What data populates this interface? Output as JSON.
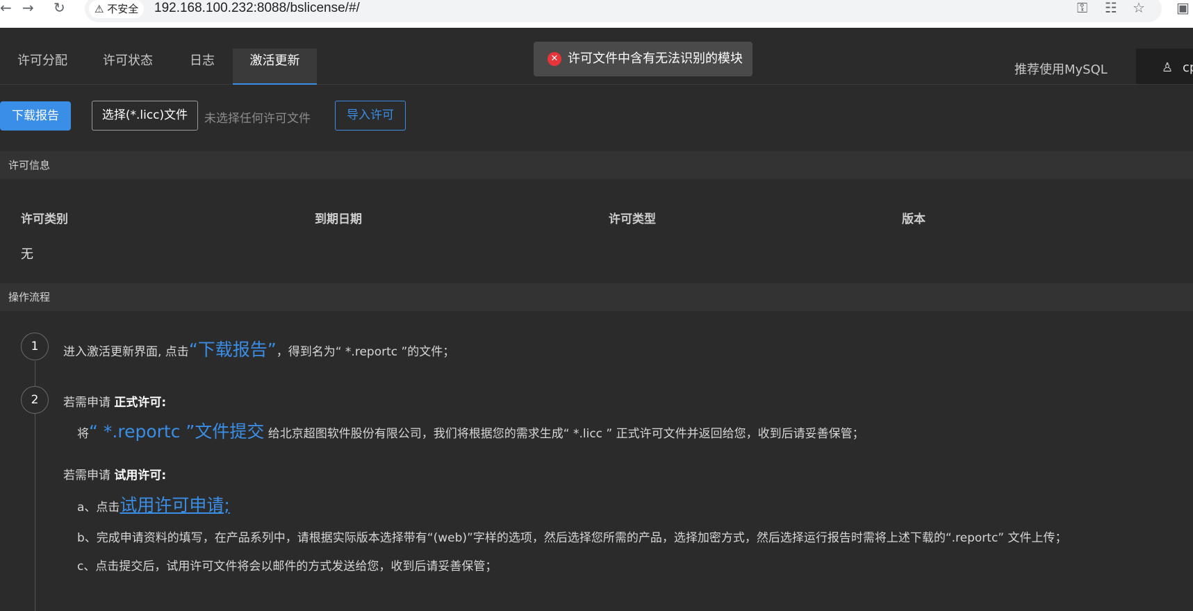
{
  "browser": {
    "back_icon": "back-arrow-icon",
    "forward_icon": "forward-arrow-icon",
    "reload_icon": "reload-icon",
    "security_label": "不安全",
    "url": "192.168.100.232:8088/bslicense/#/"
  },
  "header": {
    "tabs": [
      {
        "label": "许可分配"
      },
      {
        "label": "许可状态"
      },
      {
        "label": "日志"
      },
      {
        "label": "激活更新"
      }
    ],
    "recommend_text": "推荐使用MySQL",
    "user_name": "cp"
  },
  "toast": {
    "message": "许可文件中含有无法识别的模块"
  },
  "toolbar": {
    "download_label": "下载报告",
    "choose_file_label": "选择(*.licc)文件",
    "no_file_text": "未选择任何许可文件",
    "import_label": "导入许可"
  },
  "license_info": {
    "section_title": "许可信息",
    "columns": [
      "许可类别",
      "到期日期",
      "许可类型",
      "版本"
    ],
    "rows": [
      [
        "无",
        "",
        "",
        ""
      ]
    ]
  },
  "workflow": {
    "section_title": "操作流程",
    "step1": {
      "number": "1",
      "prefix": "进入激活更新界面, 点击",
      "highlight": "“下载报告”",
      "suffix": "，得到名为“ *.reportc ”的文件；"
    },
    "step2": {
      "number": "2",
      "formal_prefix": "若需申请",
      "formal_bold": "正式许可:",
      "formal_line_prefix": "将",
      "formal_line_highlight": "“ *.reportc ”文件提交",
      "formal_line_suffix": "给北京超图软件股份有限公司，我们将根据您的需求生成“ *.licc ” 正式许可文件并返回给您，收到后请妥善保管；",
      "trial_prefix": "若需申请",
      "trial_bold": "试用许可:",
      "trial_a_prefix": "a、点击",
      "trial_a_link": "试用许可申请;",
      "trial_b": "b、完成申请资料的填写，在产品系列中，请根据实际版本选择带有“(web)”字样的选项，然后选择您所需的产品，选择加密方式，然后选择运行报告时需将上述下载的“.reportc” 文件上传；",
      "trial_c": "c、点击提交后，试用许可文件将会以邮件的方式发送给您，收到后请妥善保管；"
    }
  }
}
